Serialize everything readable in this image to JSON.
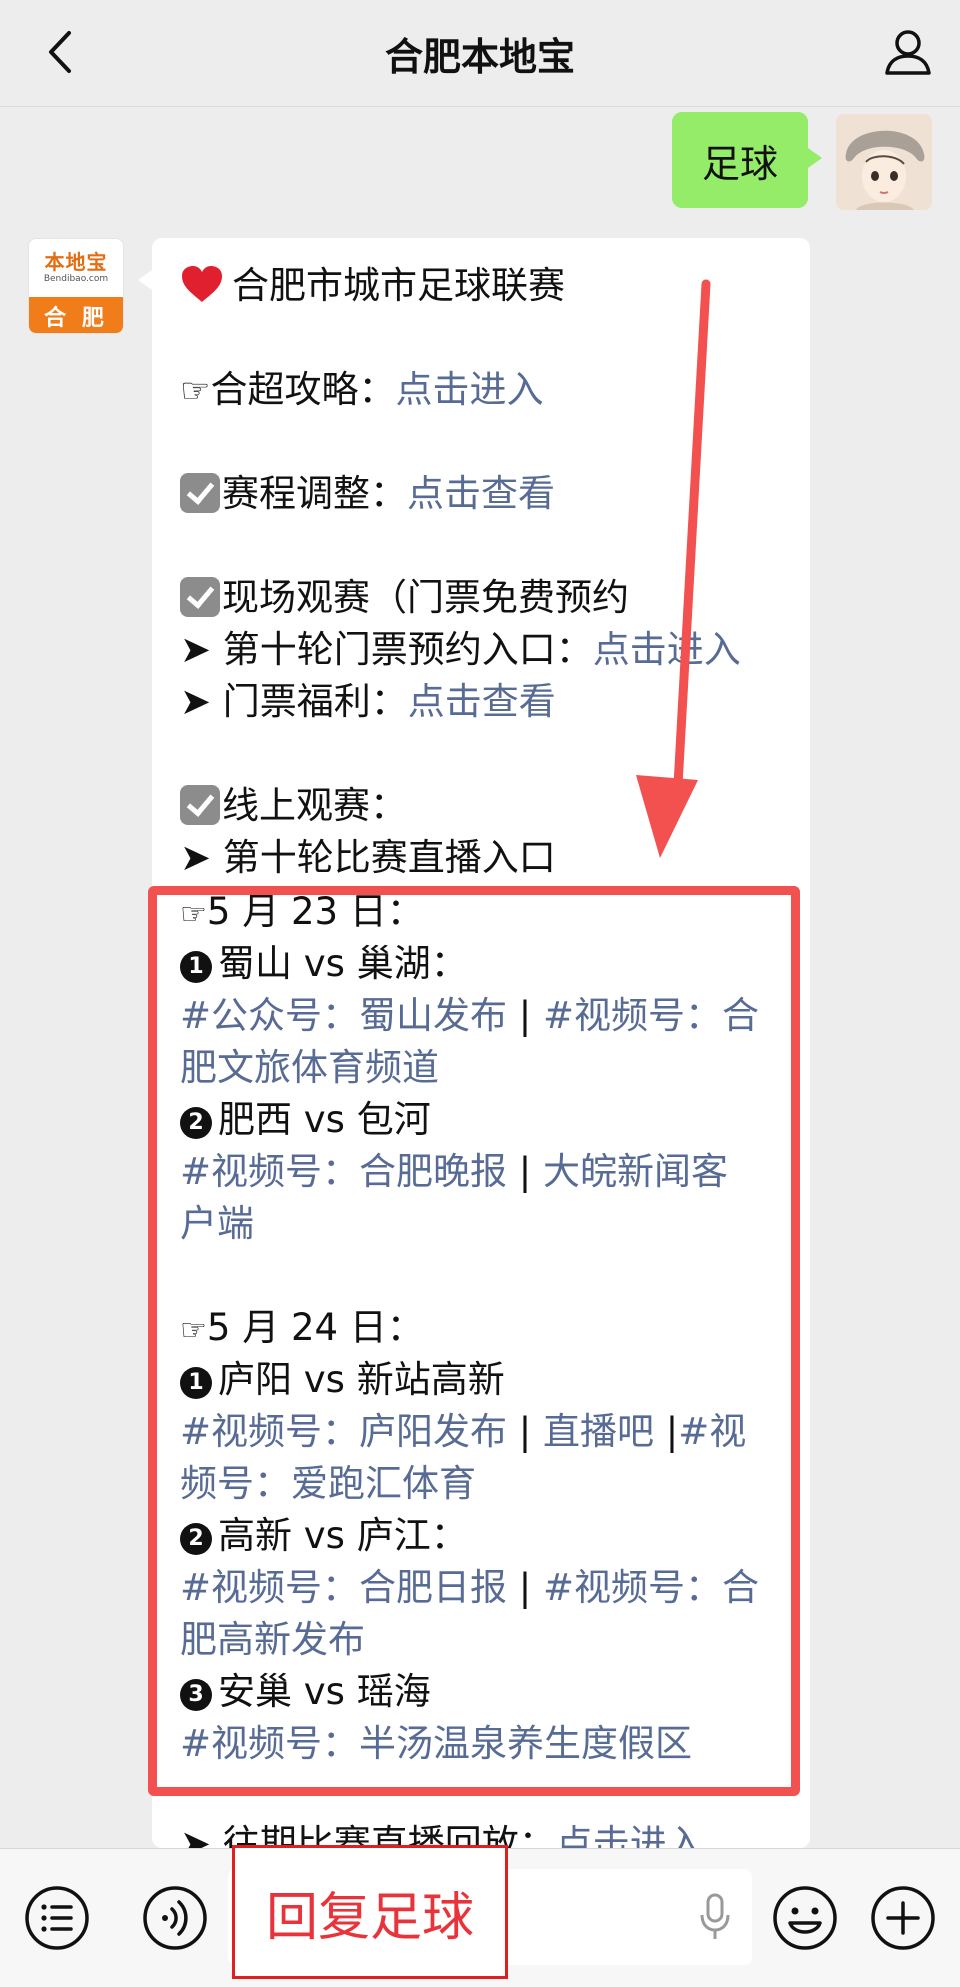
{
  "header": {
    "title": "合肥本地宝",
    "back_icon": "chevron-left-icon",
    "profile_icon": "person-icon"
  },
  "user_message": {
    "text": "足球"
  },
  "bot": {
    "avatar_brand": "本地宝",
    "avatar_domain": "Bendibao.com",
    "avatar_city": "合 肥"
  },
  "message": {
    "heading": "合肥市城市足球联赛",
    "l1_label": "合超攻略：",
    "l1_link": "点击进入",
    "l2_label": "赛程调整：",
    "l2_link": "点击查看",
    "l3_label": "现场观赛（门票免费预约",
    "l4_label": "第十轮门票预约入口：",
    "l4_link": "点击进入",
    "l5_label": "门票福利：",
    "l5_link": "点击查看",
    "l6_label": "线上观赛：",
    "l7_label": "第十轮比赛直播入口",
    "day1": "5 月 23 日：",
    "m1": "蜀山 vs 巢湖：",
    "m1_link_a": "#公众号：蜀山发布",
    "m1_link_b": "#视频号：合",
    "m1_link_c": "肥文旅体育频道",
    "m2": "肥西 vs 包河",
    "m2_link_a": "#视频号：合肥晚报",
    "m2_link_b": "大皖新闻客",
    "m2_link_c": "户端",
    "day2": "5 月 24 日：",
    "m3": "庐阳 vs 新站高新",
    "m3_link_a": "#视频号：庐阳发布",
    "m3_link_b": "直播吧",
    "m3_link_c": "#视",
    "m3_link_d": "频号：爱跑汇体育",
    "m4": "高新 vs 庐江：",
    "m4_link_a": "#视频号：合肥日报",
    "m4_link_b": "#视频号：合",
    "m4_link_c": "肥高新发布",
    "m5": "安巢 vs 瑶海",
    "m5_link_a": "#视频号：半汤温泉养生度假区",
    "l_last_label": "往期比赛直播回放：",
    "l_last_link": "点击进入",
    "sep": "|",
    "bullet_1": "1",
    "bullet_2": "2",
    "bullet_3": "3"
  },
  "bottom_bar": {
    "overlay_text": "回复足球",
    "icons": [
      "menu-list-icon",
      "voice-icon",
      "mic-icon",
      "emoji-icon",
      "plus-icon"
    ]
  },
  "colors": {
    "link": "#576b95",
    "user_bubble": "#95ec69",
    "highlight": "#f2514f"
  }
}
